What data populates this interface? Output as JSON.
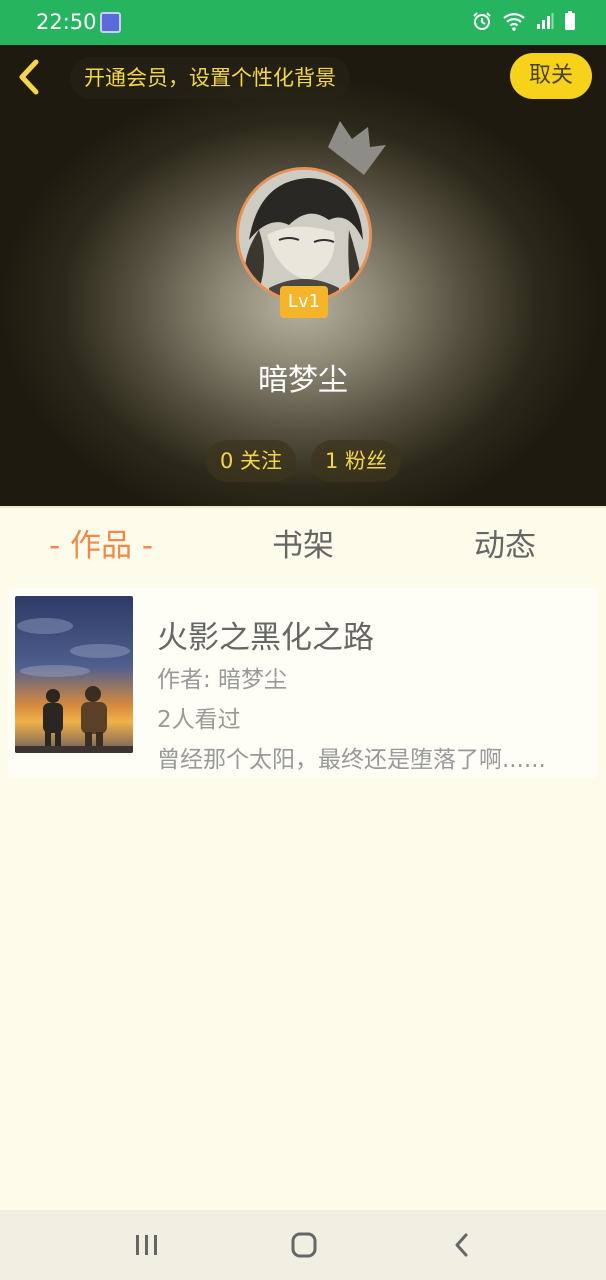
{
  "status_bar": {
    "time": "22:50",
    "icons": [
      "app-notification-icon",
      "alarm-icon",
      "wifi-icon",
      "signal-icon",
      "battery-icon"
    ]
  },
  "header": {
    "vip_promo": "开通会员，设置个性化背景",
    "unfollow_label": "取关"
  },
  "profile": {
    "level": "Lv1",
    "username": "暗梦尘",
    "following": "0 关注",
    "followers": "1 粉丝"
  },
  "tabs": [
    {
      "label": "- 作品 -",
      "active": true
    },
    {
      "label": "书架",
      "active": false
    },
    {
      "label": "动态",
      "active": false
    }
  ],
  "books": [
    {
      "title": "火影之黑化之路",
      "author": "作者: 暗梦尘",
      "views": "2人看过",
      "description": "曾经那个太阳，最终还是堕落了啊......"
    }
  ],
  "colors": {
    "status_bar": "#27b45f",
    "accent_yellow": "#f7d21a",
    "active_tab": "#f08a4b",
    "level_badge": "#f4b52b",
    "page_bg": "#fdfbe9"
  }
}
